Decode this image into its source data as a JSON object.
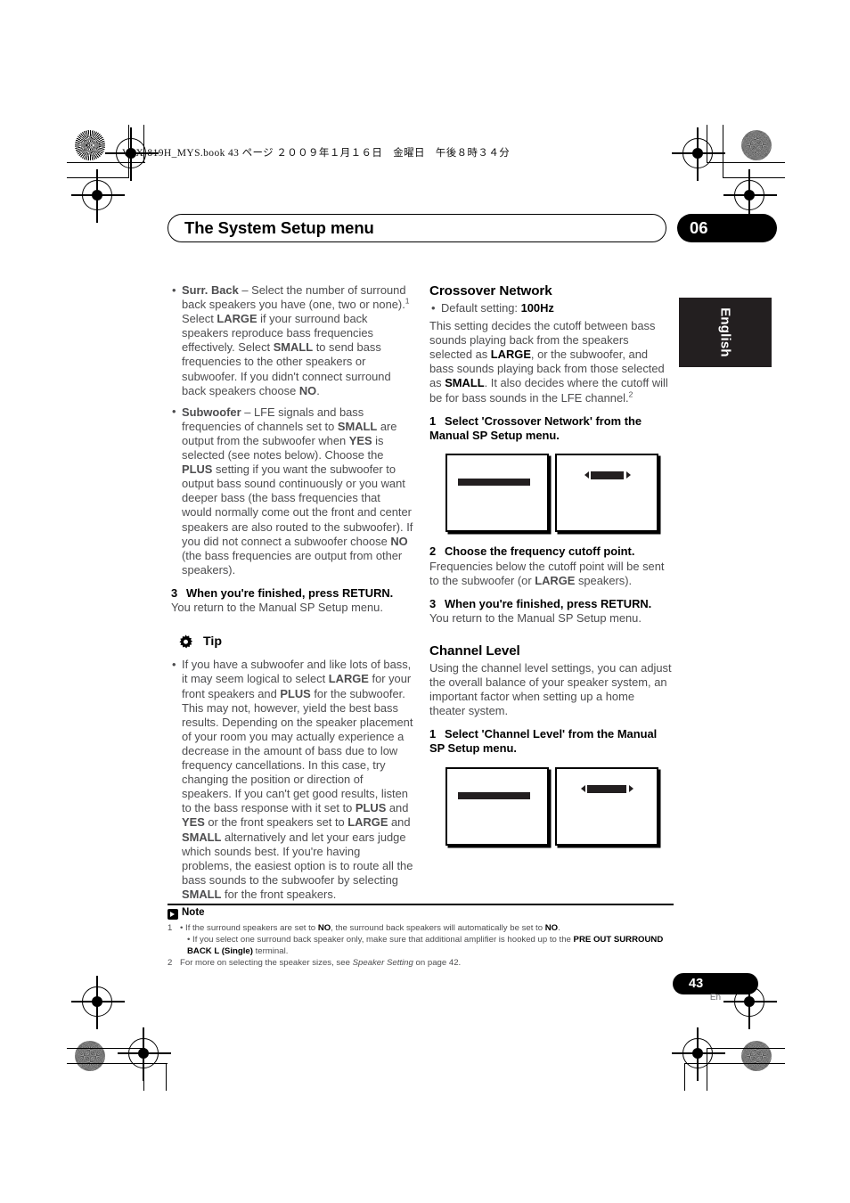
{
  "print_marks": {
    "filepath": "VSX-819H_MYS.book   43 ページ   ２００９年１月１６日　金曜日　午後８時３４分"
  },
  "header": {
    "title": "The System Setup menu",
    "chapter_number": "06",
    "language_tab": "English"
  },
  "left_column": {
    "bullets": [
      {
        "term": "Surr. Back",
        "html": "<b>Surr. Back</b> – Select the number of surround back speakers you have (one, two or none).<sup>1</sup> Select <b>LARGE</b> if your surround back speakers reproduce bass frequencies effectively. Select <b>SMALL</b> to send bass frequencies to the other speakers or subwoofer. If you didn't connect surround back speakers choose <b>NO</b>."
      },
      {
        "term": "Subwoofer",
        "html": "<b>Subwoofer</b> – LFE signals and bass frequencies of channels set to <b>SMALL</b> are output from the subwoofer when <b>YES</b> is selected (see notes below). Choose the <b>PLUS</b> setting if you want the subwoofer to output bass sound continuously or you want deeper bass (the bass frequencies that would normally come out the front and center speakers are also routed to the subwoofer). If you did not connect a subwoofer choose <b>NO</b> (the bass frequencies are output from other speakers)."
      }
    ],
    "step3": {
      "index": "3",
      "heading": "When you're finished, press RETURN.",
      "body": "You return to the Manual SP Setup menu."
    },
    "tip": {
      "label": "Tip",
      "icon": "gear-icon",
      "body_html": "If you have a subwoofer and like lots of bass, it may seem logical to select <b>LARGE</b> for your front speakers and <b>PLUS</b> for the subwoofer. This may not, however, yield the best bass results. Depending on the speaker placement of your room you may actually experience a decrease in the amount of bass due to low frequency cancellations. In this case, try changing the position or direction of speakers. If you can't get good results, listen to the bass response with it set to <b>PLUS</b> and <b>YES</b> or the front speakers set to <b>LARGE</b> and <b>SMALL</b> alternatively and let your ears judge which sounds best. If you're having problems, the easiest option is to route all the bass sounds to the subwoofer by selecting <b>SMALL</b> for the front speakers."
    }
  },
  "right_column": {
    "crossover": {
      "heading": "Crossover Network",
      "default_setting_label": "Default setting: ",
      "default_setting_value": "100Hz",
      "body_html": "This setting decides the cutoff between bass sounds playing back from the speakers selected as <b>LARGE</b>, or the subwoofer, and bass sounds playing back from those selected as <b>SMALL</b>. It also decides where the cutoff will be for bass sounds in the LFE channel.<sup>2</sup>",
      "step1": {
        "index": "1",
        "heading": "Select 'Crossover Network' from the Manual SP Setup menu."
      },
      "step2": {
        "index": "2",
        "heading": "Choose the frequency cutoff point.",
        "body_html": "Frequencies below the cutoff point will be sent to the subwoofer (or <b>LARGE</b> speakers)."
      },
      "step3": {
        "index": "3",
        "heading": "When you're finished, press RETURN.",
        "body": "You return to the Manual SP Setup menu."
      }
    },
    "channel_level": {
      "heading": "Channel Level",
      "body": "Using the channel level settings, you can adjust the overall balance of your speaker system, an important factor when setting up a home theater system.",
      "step1": {
        "index": "1",
        "heading": "Select 'Channel Level' from the Manual SP Setup menu."
      }
    }
  },
  "notes": {
    "label": "Note",
    "icon": "note-icon",
    "items": [
      {
        "marker": "1",
        "html": "• If the surround speakers are set to <b>NO</b>, the surround back speakers will automatically be set to <b>NO</b>."
      },
      {
        "marker": "",
        "html": "• If you select one surround back speaker only, make sure that additional amplifier is hooked up to the <b>PRE OUT SURROUND BACK L (Single)</b> terminal."
      },
      {
        "marker": "2",
        "html": "For more on selecting the speaker sizes, see <i>Speaker Setting</i> on page 42."
      }
    ]
  },
  "footer": {
    "page_number": "43",
    "language_code": "En"
  }
}
